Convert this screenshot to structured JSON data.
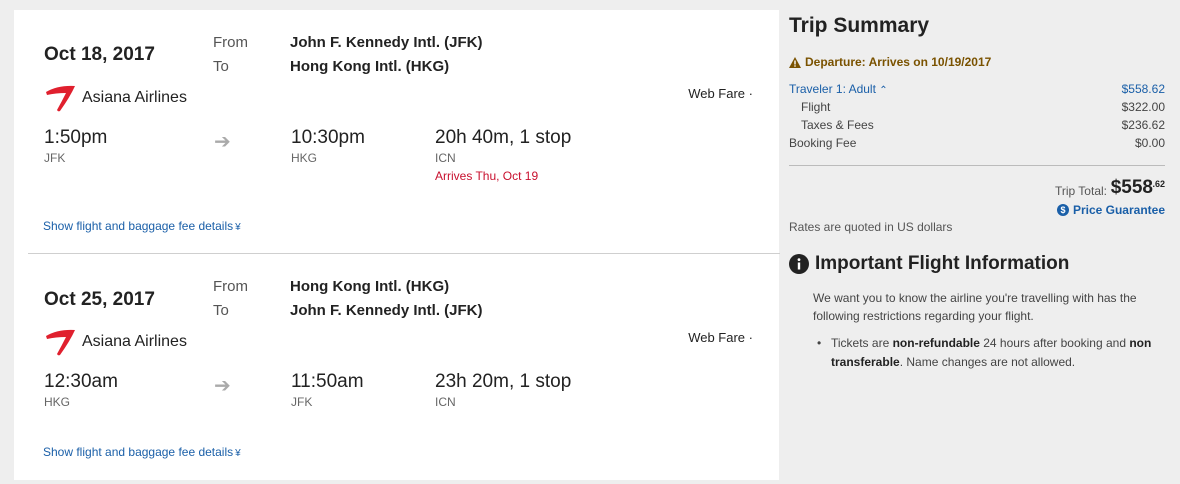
{
  "legs": [
    {
      "date": "Oct 18, 2017",
      "airline": "Asiana Airlines",
      "from_label": "From",
      "to_label": "To",
      "from": "John F. Kennedy Intl. (JFK)",
      "to": "Hong Kong Intl. (HKG)",
      "fare": "Web Fare",
      "depart_time": "1:50pm",
      "depart_code": "JFK",
      "arrive_time": "10:30pm",
      "arrive_code": "HKG",
      "duration": "20h 40m, 1 stop",
      "stop_code": "ICN",
      "arrives_note": "Arrives Thu, Oct 19",
      "details_link": "Show flight and baggage fee details"
    },
    {
      "date": "Oct 25, 2017",
      "airline": "Asiana Airlines",
      "from_label": "From",
      "to_label": "To",
      "from": "Hong Kong Intl. (HKG)",
      "to": "John F. Kennedy Intl. (JFK)",
      "fare": "Web Fare",
      "depart_time": "12:30am",
      "depart_code": "HKG",
      "arrive_time": "11:50am",
      "arrive_code": "JFK",
      "duration": "23h 20m, 1 stop",
      "stop_code": "ICN",
      "details_link": "Show flight and baggage fee details"
    }
  ],
  "summary": {
    "title": "Trip Summary",
    "warning": "Departure: Arrives on 10/19/2017",
    "traveler": "Traveler 1: Adult",
    "traveler_price": "$558.62",
    "flight_label": "Flight",
    "flight_price": "$322.00",
    "taxes_label": "Taxes & Fees",
    "taxes_price": "$236.62",
    "booking_label": "Booking Fee",
    "booking_price": "$0.00",
    "total_label": "Trip Total:",
    "total_amount": "$558",
    "total_cents": ".62",
    "price_guarantee": "Price Guarantee",
    "rates_note": "Rates are quoted in US dollars"
  },
  "info": {
    "title": "Important Flight Information",
    "intro": "We want you to know the airline you're travelling with has the following restrictions regarding your flight.",
    "bullet_pre": "Tickets are ",
    "bullet_bold1": "non-refundable",
    "bullet_mid": " 24 hours after booking and ",
    "bullet_bold2": "non transferable",
    "bullet_post": ". Name changes are not allowed."
  },
  "colors": {
    "link": "#1a5fa8",
    "alert_red": "#c8102e",
    "warning": "#7a5200",
    "asiana_logo": "#e0202e"
  },
  "icons": [
    "asiana-logo",
    "arrow-right-icon",
    "chevron-double-down-icon",
    "warning-icon",
    "chevron-double-up-icon",
    "dollar-circle-icon",
    "info-icon"
  ]
}
